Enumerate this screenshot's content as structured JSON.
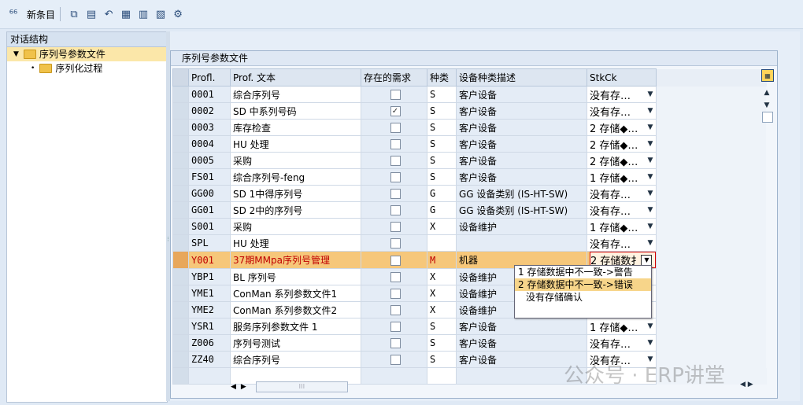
{
  "toolbar": {
    "new_entries_label": "新条目",
    "icons": [
      "glasses-icon",
      "copy-icon",
      "delete-icon",
      "undo-icon",
      "select-all-icon",
      "select-block-icon",
      "deselect-icon",
      "config-icon"
    ]
  },
  "tree": {
    "header": "对话结构",
    "items": [
      {
        "label": "序列号参数文件",
        "expanded": true,
        "selected": true
      },
      {
        "label": "序列化过程",
        "expanded": false,
        "selected": false
      }
    ]
  },
  "panel": {
    "title": "序列号参数文件"
  },
  "table": {
    "columns": [
      "Profl.",
      "Prof. 文本",
      "存在的需求",
      "种类",
      "设备种类描述",
      "StkCk"
    ],
    "rows": [
      {
        "profl": "0001",
        "text": "综合序列号",
        "req": false,
        "cat": "S",
        "desc": "客户设备",
        "stkck": "没有存…"
      },
      {
        "profl": "0002",
        "text": "SD 中系列号码",
        "req": true,
        "cat": "S",
        "desc": "客户设备",
        "stkck": "没有存…"
      },
      {
        "profl": "0003",
        "text": "库存检查",
        "req": false,
        "cat": "S",
        "desc": "客户设备",
        "stkck": "2 存储◆…"
      },
      {
        "profl": "0004",
        "text": "HU 处理",
        "req": false,
        "cat": "S",
        "desc": "客户设备",
        "stkck": "2 存储◆…"
      },
      {
        "profl": "0005",
        "text": "采购",
        "req": false,
        "cat": "S",
        "desc": "客户设备",
        "stkck": "2 存储◆…"
      },
      {
        "profl": "FS01",
        "text": "综合序列号-feng",
        "req": false,
        "cat": "S",
        "desc": "客户设备",
        "stkck": "1 存储◆…"
      },
      {
        "profl": "GG00",
        "text": "SD 1中得序列号",
        "req": false,
        "cat": "G",
        "desc": "GG 设备类别 (IS-HT-SW)",
        "stkck": "没有存…"
      },
      {
        "profl": "GG01",
        "text": "SD 2中的序列号",
        "req": false,
        "cat": "G",
        "desc": "GG 设备类别 (IS-HT-SW)",
        "stkck": "没有存…"
      },
      {
        "profl": "S001",
        "text": "采购",
        "req": false,
        "cat": "X",
        "desc": "设备维护",
        "stkck": "1 存储◆…"
      },
      {
        "profl": "SPL",
        "text": "HU 处理",
        "req": false,
        "cat": "",
        "desc": "",
        "stkck": "没有存…"
      },
      {
        "profl": "Y001",
        "text": "37期MMpa序列号管理",
        "req": false,
        "cat": "M",
        "desc": "机器",
        "stkck": "2 存储数扌",
        "highlight": true
      },
      {
        "profl": "YBP1",
        "text": "BL 序列号",
        "req": false,
        "cat": "X",
        "desc": "设备维护",
        "stkck": ""
      },
      {
        "profl": "YME1",
        "text": "ConMan 系列参数文件1",
        "req": false,
        "cat": "X",
        "desc": "设备维护",
        "stkck": ""
      },
      {
        "profl": "YME2",
        "text": "ConMan 系列参数文件2",
        "req": false,
        "cat": "X",
        "desc": "设备维护",
        "stkck": ""
      },
      {
        "profl": "YSR1",
        "text": "服务序列参数文件 1",
        "req": false,
        "cat": "S",
        "desc": "客户设备",
        "stkck": "1 存储◆…"
      },
      {
        "profl": "Z006",
        "text": "序列号测试",
        "req": false,
        "cat": "S",
        "desc": "客户设备",
        "stkck": "没有存…"
      },
      {
        "profl": "ZZ40",
        "text": "综合序列号",
        "req": false,
        "cat": "S",
        "desc": "客户设备",
        "stkck": "没有存…"
      }
    ]
  },
  "dropdown": {
    "options": [
      {
        "label": "1 存储数据中不一致->警告",
        "selected": false
      },
      {
        "label": "2 存储数据中不一致->错误",
        "selected": true
      },
      {
        "label": "没有存储确认",
        "selected": false
      }
    ]
  },
  "watermark": "公众号 · ERP讲堂"
}
